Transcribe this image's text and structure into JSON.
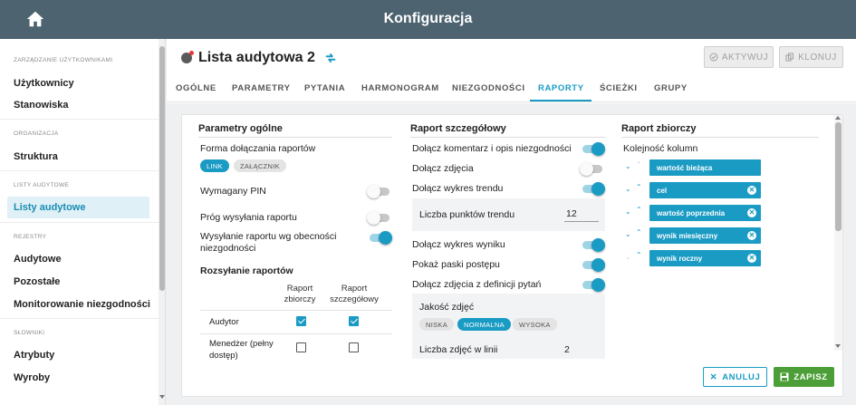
{
  "app": {
    "title": "Konfiguracja"
  },
  "sidebar": {
    "sections": [
      {
        "label": "ZARZĄDZANIE UŻYTKOWNIKAMI",
        "items": [
          "Użytkownicy",
          "Stanowiska"
        ]
      },
      {
        "label": "ORGANIZACJA",
        "items": [
          "Struktura"
        ]
      },
      {
        "label": "LISTY AUDYTOWE",
        "items": [
          "Listy audytowe"
        ]
      },
      {
        "label": "REJESTRY",
        "items": [
          "Audytowe",
          "Pozostałe",
          "Monitorowanie niezgodności"
        ]
      },
      {
        "label": "SŁOWNIKI",
        "items": [
          "Atrybuty",
          "Wyroby"
        ]
      }
    ],
    "active_item": "Listy audytowe"
  },
  "document": {
    "title": "Lista audytowa 2",
    "activate_label": "AKTYWUJ",
    "clone_label": "KLONUJ"
  },
  "tabs": [
    "OGÓLNE",
    "PARAMETRY",
    "PYTANIA",
    "HARMONOGRAM",
    "NIEZGODNOŚCI",
    "RAPORTY",
    "ŚCIEŻKI",
    "GRUPY"
  ],
  "active_tab": "RAPORTY",
  "general": {
    "title": "Parametry ogólne",
    "attach_label": "Forma dołączania raportów",
    "attach_options": [
      "LINK",
      "ZAŁĄCZNIK"
    ],
    "attach_selected": "LINK",
    "pin_label": "Wymagany PIN",
    "pin_on": false,
    "threshold_label": "Próg wysyłania raportu",
    "threshold_on": false,
    "nonconf_label": "Wysyłanie raportu wg obecności niezgodności",
    "nonconf_on": true,
    "dist_title": "Rozsyłanie raportów",
    "dist_headers": [
      "Raport zbiorczy",
      "Raport szczegółowy"
    ],
    "dist_rows": [
      {
        "label": "Audytor",
        "summary": true,
        "detailed": true
      },
      {
        "label": "Menedżer (pełny dostęp)",
        "summary": false,
        "detailed": false
      }
    ]
  },
  "detailed": {
    "title": "Raport szczegółowy",
    "rows": [
      {
        "label": "Dołącz komentarz i opis niezgodności",
        "on": true
      },
      {
        "label": "Dołącz zdjęcia",
        "on": false
      },
      {
        "label": "Dołącz wykres trendu",
        "on": true
      },
      {
        "label": "Dołącz wykres wyniku",
        "on": true
      },
      {
        "label": "Pokaż paski postępu",
        "on": true
      },
      {
        "label": "Dołącz zdjęcia z definicji pytań",
        "on": true
      }
    ],
    "trend_points_label": "Liczba punktów trendu",
    "trend_points_value": "12",
    "photo_quality_label": "Jakość zdjęć",
    "photo_quality_options": [
      "NISKA",
      "NORMALNA",
      "WYSOKA"
    ],
    "photo_quality_selected": "NORMALNA",
    "photos_per_line_label": "Liczba zdjęć w linii",
    "photos_per_line_value": "2"
  },
  "summary": {
    "title": "Raport zbiorczy",
    "order_label": "Kolejność kolumn",
    "columns": [
      "wartość bieżąca",
      "cel",
      "wartość poprzednia",
      "wynik miesięczny",
      "wynik roczny"
    ]
  },
  "actions": {
    "cancel_label": "ANULUJ",
    "save_label": "ZAPISZ"
  },
  "colors": {
    "header": "#4d6370",
    "accent": "#1a9bc4",
    "save": "#4c9f38"
  }
}
